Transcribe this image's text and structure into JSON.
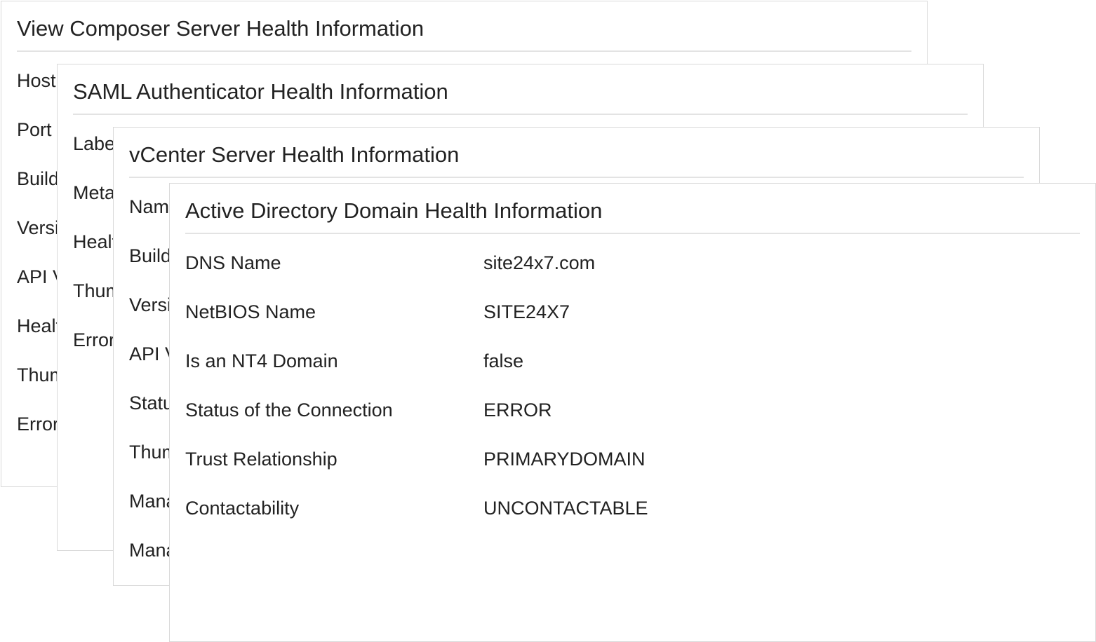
{
  "cards": {
    "composer": {
      "title": "View Composer Server Health Information",
      "rows": [
        {
          "label": "Host"
        },
        {
          "label": "Port"
        },
        {
          "label": "Build"
        },
        {
          "label": "Version"
        },
        {
          "label": "API Version"
        },
        {
          "label": "Health"
        },
        {
          "label": "Thumbprint"
        },
        {
          "label": "Error"
        }
      ]
    },
    "saml": {
      "title": "SAML Authenticator Health Information",
      "rows": [
        {
          "label": "Label"
        },
        {
          "label": "Metadata"
        },
        {
          "label": "Health"
        },
        {
          "label": "Thumbprint"
        },
        {
          "label": "Error"
        }
      ]
    },
    "vcenter": {
      "title": "vCenter Server Health Information",
      "rows": [
        {
          "label": "Name"
        },
        {
          "label": "Build"
        },
        {
          "label": "Version"
        },
        {
          "label": "API Version"
        },
        {
          "label": "Status"
        },
        {
          "label": "Thumbprint"
        },
        {
          "label": "Manager"
        },
        {
          "label": "Manager"
        }
      ]
    },
    "ad": {
      "title": "Active Directory Domain Health Information",
      "rows": [
        {
          "label": "DNS Name",
          "value": "site24x7.com"
        },
        {
          "label": "NetBIOS Name",
          "value": "SITE24X7"
        },
        {
          "label": "Is an NT4 Domain",
          "value": "false"
        },
        {
          "label": "Status of the Connection",
          "value": "ERROR"
        },
        {
          "label": "Trust Relationship",
          "value": "PRIMARYDOMAIN"
        },
        {
          "label": "Contactability",
          "value": "UNCONTACTABLE"
        }
      ]
    }
  }
}
